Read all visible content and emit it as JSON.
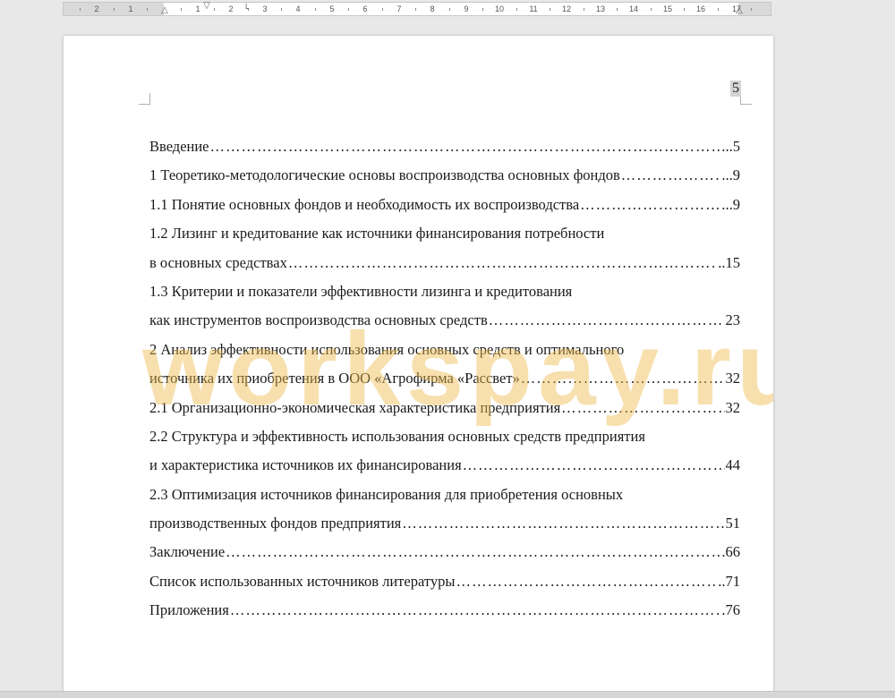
{
  "ruler": {
    "numbers": [
      "2",
      "1",
      "1",
      "2",
      "3",
      "4",
      "5",
      "6",
      "7",
      "8",
      "9",
      "10",
      "11",
      "12",
      "13",
      "14",
      "15",
      "16",
      "17"
    ]
  },
  "document": {
    "page_number": "5",
    "watermark": "workspay.ru",
    "toc": [
      {
        "text": "Введение",
        "page": "..5"
      },
      {
        "text": "1 Теоретико-методологические основы воспроизводства основных фондов",
        "page": "...9"
      },
      {
        "text": "1.1  Понятие основных фондов и необходимость их воспроизводства",
        "page": "..9"
      },
      {
        "text": "1.2 Лизинг и кредитование как источники финансирования потребности"
      },
      {
        "text": "в основных средствах",
        "page": "..15"
      },
      {
        "text": "1.3 Критерии и показатели эффективности лизинга и кредитования"
      },
      {
        "text": "как инструментов воспроизводства основных средств",
        "page": "23"
      },
      {
        "text": "2 Анализ эффективности использования основных средств и оптимального"
      },
      {
        "text": "источника их приобретения в ООО «Агрофирма «Рассвет»",
        "page": "32"
      },
      {
        "text": "2.1 Организационно-экономическая характеристика предприятия",
        "page": "32"
      },
      {
        "text": "2.2 Структура и эффективность использования основных средств предприятия"
      },
      {
        "text": "и характеристика источников их финансирования",
        "page": "44"
      },
      {
        "text": "2.3 Оптимизация источников финансирования для приобретения основных"
      },
      {
        "text": "производственных фондов предприятия",
        "page": "51"
      },
      {
        "text": "Заключение",
        "page": ".66"
      },
      {
        "text": "Список использованных источников литературы",
        "page": "..71"
      },
      {
        "text": "Приложения",
        "page": ".76"
      }
    ]
  }
}
